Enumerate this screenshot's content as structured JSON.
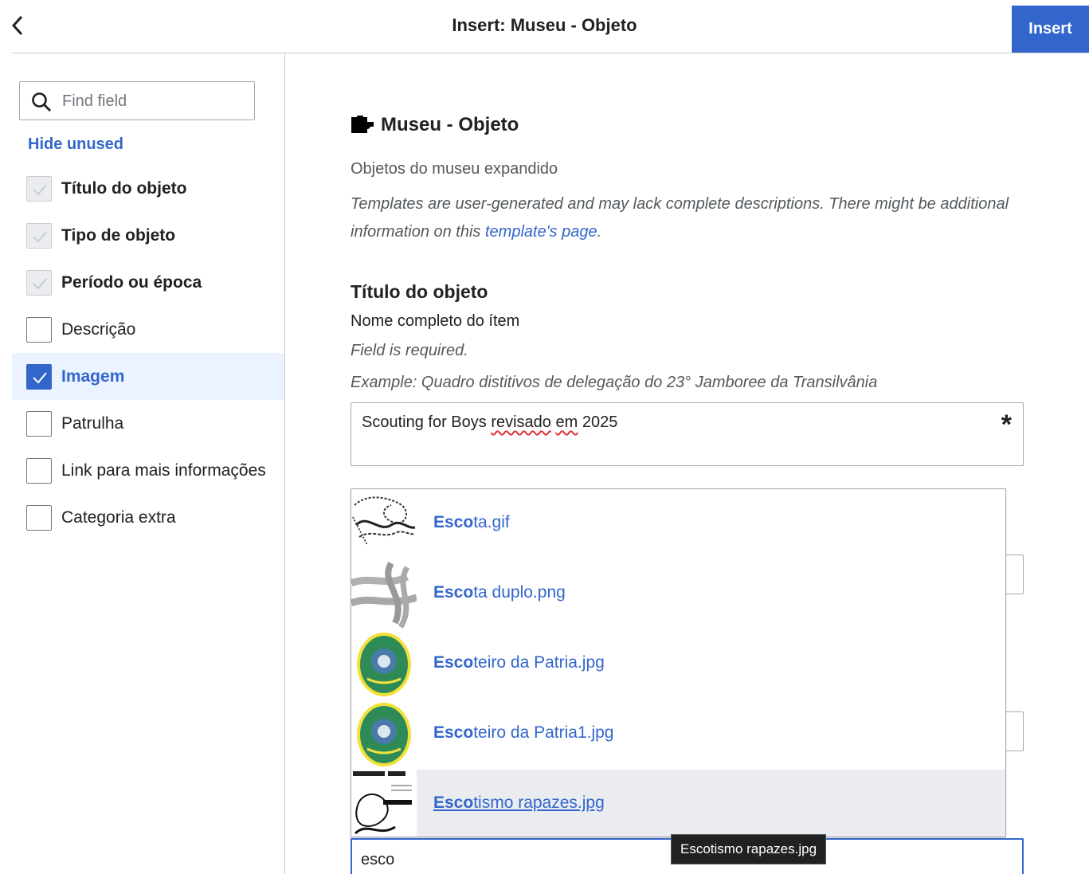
{
  "header": {
    "title": "Insert: Museu - Objeto",
    "insert_label": "Insert"
  },
  "sidebar": {
    "search_placeholder": "Find field",
    "hide_unused_label": "Hide unused",
    "fields": [
      {
        "label": "Título do objeto",
        "state": "required"
      },
      {
        "label": "Tipo de objeto",
        "state": "required"
      },
      {
        "label": "Período ou época",
        "state": "required"
      },
      {
        "label": "Descrição",
        "state": "unchecked"
      },
      {
        "label": "Imagem",
        "state": "checked"
      },
      {
        "label": "Patrulha",
        "state": "unchecked"
      },
      {
        "label": "Link para mais informações",
        "state": "unchecked"
      },
      {
        "label": "Categoria extra",
        "state": "unchecked"
      }
    ]
  },
  "template": {
    "name": "Museu - Objeto",
    "description": "Objetos do museu expandido",
    "note_before": "Templates are user-generated and may lack complete descriptions. There might be additional information on this ",
    "note_link": "template's page",
    "note_after": "."
  },
  "field": {
    "title": "Título do objeto",
    "description": "Nome completo do ítem",
    "required_text": "Field is required.",
    "example": "Example: Quadro distitivos de delegação do 23° Jamboree da Transilvânia",
    "value_part1": "Scouting for Boys ",
    "value_part2": "revisado",
    "value_part3": " ",
    "value_part4": "em",
    "value_part5": " 2025",
    "required_marker": "*"
  },
  "dropdown": {
    "items": [
      {
        "match": "Esco",
        "rest": "ta.gif",
        "thumb": "knot-sketch"
      },
      {
        "match": "Esco",
        "rest": "ta duplo.png",
        "thumb": "knot-gray"
      },
      {
        "match": "Esco",
        "rest": "teiro da Patria.jpg",
        "thumb": "emblem"
      },
      {
        "match": "Esco",
        "rest": "teiro da Patria1.jpg",
        "thumb": "emblem"
      },
      {
        "match": "Esco",
        "rest": "tismo rapazes.jpg",
        "thumb": "book-cover"
      }
    ]
  },
  "image_search": {
    "value": "esco"
  },
  "tooltip": {
    "text": "Escotismo rapazes.jpg"
  },
  "colors": {
    "accent": "#3366cc",
    "hover_bg": "#eaecf0",
    "selected_bg": "#eaf3ff"
  }
}
